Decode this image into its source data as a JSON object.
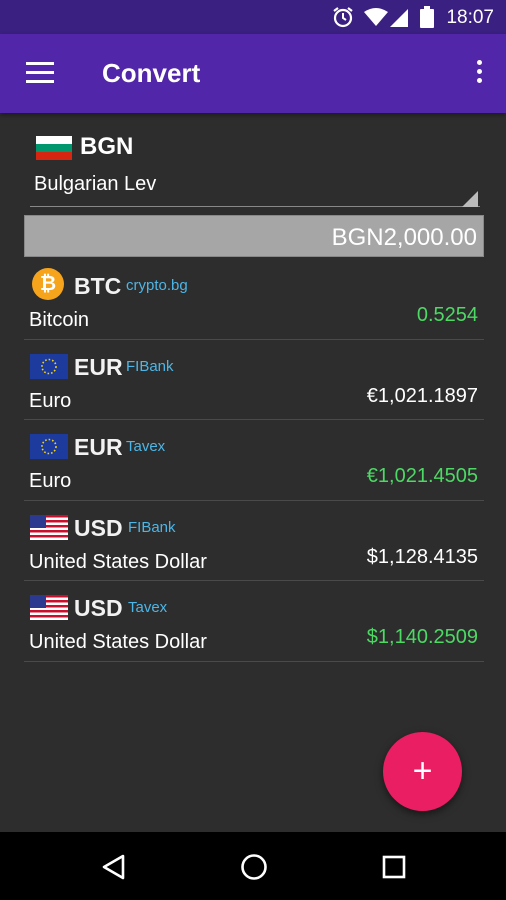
{
  "status_bar": {
    "time": "18:07"
  },
  "app_bar": {
    "title": "Convert"
  },
  "base": {
    "code": "BGN",
    "name": "Bulgarian Lev",
    "amount": "BGN2,000.00"
  },
  "rows": [
    {
      "code": "BTC",
      "source": "crypto.bg",
      "name": "Bitcoin",
      "value": "0.5254",
      "value_color": "#4cd964"
    },
    {
      "code": "EUR",
      "source": "FIBank",
      "name": "Euro",
      "value": "€1,021.1897",
      "value_color": "#ffffff"
    },
    {
      "code": "EUR",
      "source": "Tavex",
      "name": "Euro",
      "value": "€1,021.4505",
      "value_color": "#4cd964"
    },
    {
      "code": "USD",
      "source": "FIBank",
      "name": "United States Dollar",
      "value": "$1,128.4135",
      "value_color": "#ffffff"
    },
    {
      "code": "USD",
      "source": "Tavex",
      "name": "United States Dollar",
      "value": "$1,140.2509",
      "value_color": "#4cd964"
    }
  ],
  "fab": {
    "label": "+"
  },
  "colors": {
    "status_bar": "#3a2080",
    "app_bar": "#5126a8",
    "background": "#2d2d2d",
    "accent": "#e91e63",
    "positive": "#4cd964",
    "source_link": "#4db6e6"
  }
}
